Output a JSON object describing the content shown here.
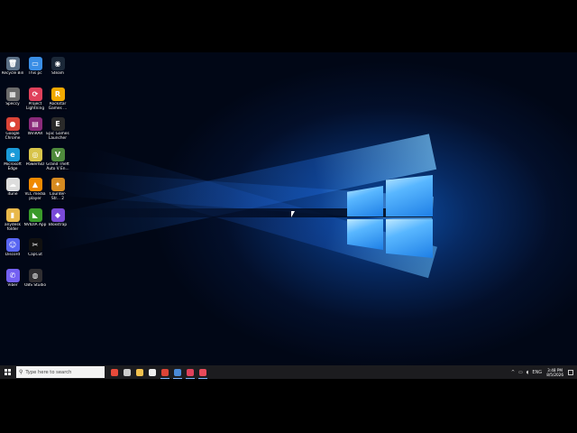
{
  "desktop": {
    "icons": [
      {
        "label": "Recycle Bin",
        "glyph": "🗑",
        "bg": "#5a6f86",
        "col": 0,
        "row": 0
      },
      {
        "label": "This pc",
        "glyph": "▭",
        "bg": "#3a8ee6",
        "col": 1,
        "row": 0
      },
      {
        "label": "Steam",
        "glyph": "◉",
        "bg": "#1b2838",
        "col": 2,
        "row": 0
      },
      {
        "label": "Speccy",
        "glyph": "▦",
        "bg": "#6b6b6b",
        "col": 0,
        "row": 1
      },
      {
        "label": "Project Lightning",
        "glyph": "⟳",
        "bg": "#e0415b",
        "col": 1,
        "row": 1
      },
      {
        "label": "Rockstar Games ...",
        "glyph": "R",
        "bg": "#f2a900",
        "col": 2,
        "row": 1
      },
      {
        "label": "Google Chrome",
        "glyph": "●",
        "bg": "#db4437",
        "col": 0,
        "row": 2
      },
      {
        "label": "WinRAR",
        "glyph": "▤",
        "bg": "#8a2a7a",
        "col": 1,
        "row": 2
      },
      {
        "label": "Epic Games Launcher",
        "glyph": "E",
        "bg": "#2a2a2a",
        "col": 2,
        "row": 2
      },
      {
        "label": "Microsoft Edge",
        "glyph": "e",
        "bg": "#1a9ad8",
        "col": 0,
        "row": 3
      },
      {
        "label": "PowerISO",
        "glyph": "◎",
        "bg": "#d8c44a",
        "col": 1,
        "row": 3
      },
      {
        "label": "Grand Theft Auto V En...",
        "glyph": "V",
        "bg": "#4f8a3c",
        "col": 2,
        "row": 3
      },
      {
        "label": "itune",
        "glyph": "☁",
        "bg": "#dddddd",
        "col": 0,
        "row": 4
      },
      {
        "label": "VLC media player",
        "glyph": "▲",
        "bg": "#f08a00",
        "col": 1,
        "row": 4
      },
      {
        "label": "Counter-Str... 2",
        "glyph": "✦",
        "bg": "#d68a20",
        "col": 2,
        "row": 4
      },
      {
        "label": "anydesk folder",
        "glyph": "▮",
        "bg": "#e8b84a",
        "col": 0,
        "row": 5
      },
      {
        "label": "NVIDIA App",
        "glyph": "◣",
        "bg": "#3a9a2a",
        "col": 1,
        "row": 5
      },
      {
        "label": "Bloxstrap",
        "glyph": "◆",
        "bg": "#7a4ad8",
        "col": 2,
        "row": 5
      },
      {
        "label": "Discord",
        "glyph": "☺",
        "bg": "#5865f2",
        "col": 0,
        "row": 6
      },
      {
        "label": "CapCut",
        "glyph": "✂",
        "bg": "#111111",
        "col": 1,
        "row": 6
      },
      {
        "label": "Viber",
        "glyph": "✆",
        "bg": "#7360f2",
        "col": 0,
        "row": 7
      },
      {
        "label": "OBS Studio",
        "glyph": "◍",
        "bg": "#302e31",
        "col": 1,
        "row": 7
      }
    ]
  },
  "taskbar": {
    "search_placeholder": "Type here to search",
    "search_icon": "search-icon",
    "apps": [
      {
        "name": "search-highlight",
        "color": "#e84a3a",
        "active": false
      },
      {
        "name": "task-view",
        "color": "#cccccc",
        "active": false
      },
      {
        "name": "file-explorer",
        "color": "#f2c14e",
        "active": false
      },
      {
        "name": "store",
        "color": "#eeeeee",
        "active": false
      },
      {
        "name": "chrome",
        "color": "#db4437",
        "active": true
      },
      {
        "name": "steam",
        "color": "#4a8ad8",
        "active": true
      },
      {
        "name": "project-lightning",
        "color": "#e0415b",
        "active": true
      },
      {
        "name": "record",
        "color": "#e84a5a",
        "active": true
      }
    ],
    "tray_language": "ENG",
    "clock_time": "3:48 PM",
    "clock_date": "8/5/2026"
  }
}
